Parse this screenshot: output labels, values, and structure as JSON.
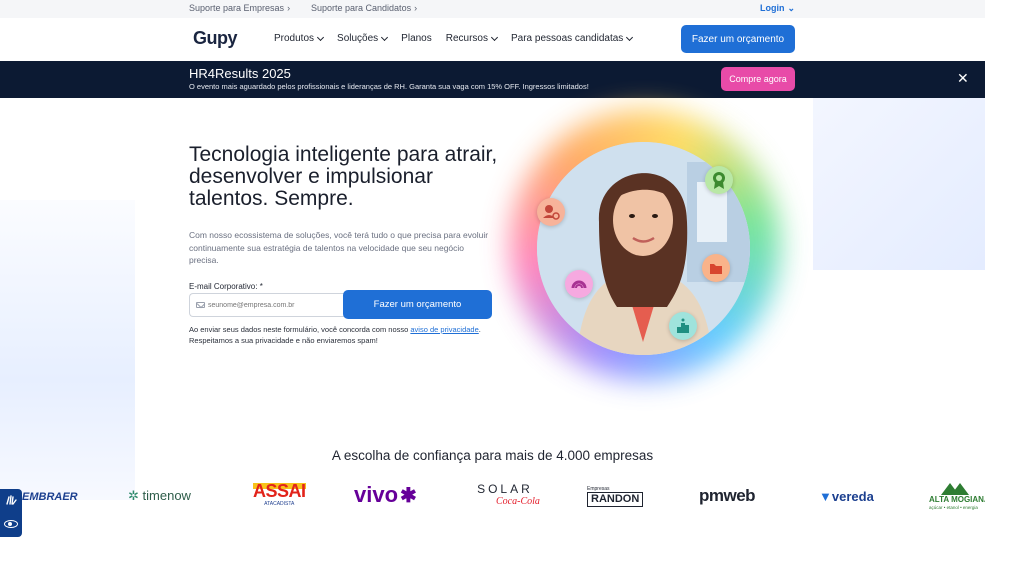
{
  "utility_bar": {
    "support_companies": "Suporte para Empresas",
    "support_candidates": "Suporte para Candidatos",
    "login": "Login"
  },
  "nav": {
    "logo": "Gupy",
    "items": [
      {
        "label": "Produtos",
        "dropdown": true
      },
      {
        "label": "Soluções",
        "dropdown": true
      },
      {
        "label": "Planos",
        "dropdown": false
      },
      {
        "label": "Recursos",
        "dropdown": true
      },
      {
        "label": "Para pessoas candidatas",
        "dropdown": true
      }
    ],
    "cta": "Fazer um orçamento"
  },
  "promo": {
    "title": "HR4Results 2025",
    "text": "O evento mais aguardado pelos profissionais e lideranças de RH. Garanta sua vaga com 15% OFF. Ingressos limitados!",
    "button": "Compre agora",
    "close": "✕"
  },
  "hero": {
    "title": "Tecnologia inteligente para atrair, desenvolver e impulsionar talentos. Sempre.",
    "subtitle": "Com nosso ecossistema de soluções, você terá tudo o que precisa para evoluir continuamente sua estratégia de talentos na velocidade que seu negócio precisa.",
    "email_label": "E-mail Corporativo: *",
    "email_placeholder": "seunome@empresa.com.br",
    "submit": "Fazer um orçamento",
    "consent_before": "Ao enviar seus dados neste formulário, você concorda com nosso ",
    "consent_link": "aviso de privacidade",
    "consent_after": ". Respeitamos a sua privacidade e não enviaremos spam!"
  },
  "trust": {
    "heading": "A escolha de confiança para mais de 4.000 empresas",
    "logos": [
      "EMBRAER",
      "timenow",
      "ASSAI",
      "ATACADISTA",
      "vivo",
      "SOLAR",
      "Coca-Cola",
      "Empresas",
      "RANDON",
      "pmweb",
      "vereda",
      "ALTA MOGIANA",
      "açúcar • etanol • energia"
    ]
  },
  "colors": {
    "primary": "#1f6fd6",
    "promo_bg": "#0c1a33",
    "promo_button": "#e84ba8",
    "a11y_bg": "#0f3e8a"
  }
}
